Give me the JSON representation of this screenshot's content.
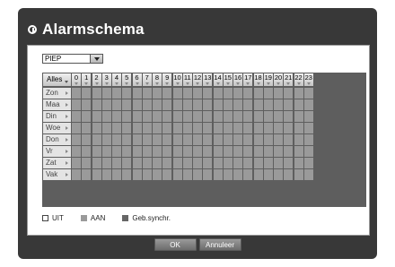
{
  "window": {
    "title": "Alarmschema",
    "title_icon": "clock-icon"
  },
  "dropdown": {
    "selected": "PIEP"
  },
  "schedule": {
    "all_label": "Alles",
    "hours": [
      "0",
      "1",
      "2",
      "3",
      "4",
      "5",
      "6",
      "7",
      "8",
      "9",
      "10",
      "11",
      "12",
      "13",
      "14",
      "15",
      "16",
      "17",
      "18",
      "19",
      "20",
      "21",
      "22",
      "23"
    ],
    "days": [
      "Zon",
      "Maa",
      "Din",
      "Woe",
      "Don",
      "Vr",
      "Zat",
      "Vak"
    ]
  },
  "legend": [
    {
      "label": "UIT",
      "color": "#ffffff",
      "border": "#444444"
    },
    {
      "label": "AAN",
      "color": "#9a9a9a",
      "border": "#9a9a9a"
    },
    {
      "label": "Geb.synchr.",
      "color": "#666666",
      "border": "#666666"
    }
  ],
  "buttons": {
    "ok": "OK",
    "cancel": "Annuleer"
  },
  "colors": {
    "window_bg": "#383838",
    "cell_on": "#9a9a9a",
    "grid_line": "#5e5e5e"
  }
}
